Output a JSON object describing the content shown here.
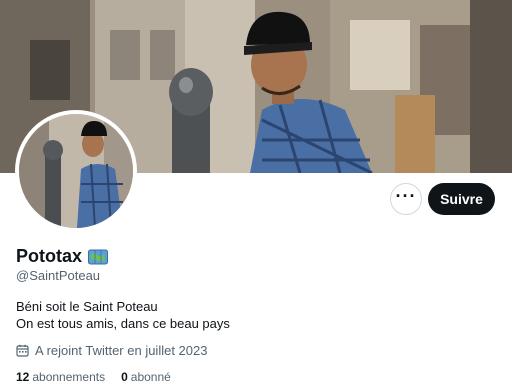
{
  "profile": {
    "display_name": "Pototax",
    "name_emoji": "map-emoji",
    "handle": "@SaintPoteau",
    "bio_line_1": "Béni soit le Saint Poteau",
    "bio_line_2": "On est tous amis, dans ce beau pays",
    "joined": "A rejoint Twitter en juillet 2023"
  },
  "actions": {
    "more_label": "···",
    "follow_label": "Suivre"
  },
  "stats": {
    "following_count": "12",
    "following_label": "abonnements",
    "followers_count": "0",
    "followers_label": "abonné"
  },
  "colors": {
    "text_primary": "#0f1419",
    "text_secondary": "#536471",
    "button_dark": "#0f1419",
    "border": "#cfd9de",
    "shirt_blue": "#4a6fa5"
  }
}
